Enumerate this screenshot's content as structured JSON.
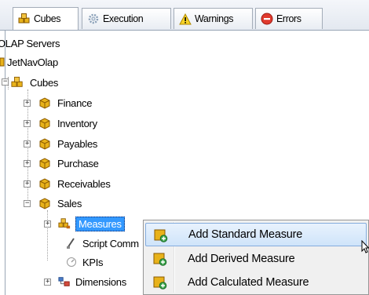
{
  "tabs": [
    {
      "label": "Cubes",
      "icon": "cubes-icon",
      "active": true
    },
    {
      "label": "Execution",
      "icon": "gear-icon",
      "active": false
    },
    {
      "label": "Warnings",
      "icon": "warning-icon",
      "active": false
    },
    {
      "label": "Errors",
      "icon": "error-icon",
      "active": false
    }
  ],
  "tree": {
    "root": "OLAP Servers",
    "server": "JetNavOlap",
    "cubes": "Cubes",
    "children": [
      "Finance",
      "Inventory",
      "Payables",
      "Purchase",
      "Receivables",
      "Sales"
    ],
    "sales_children": [
      "Measures",
      "Script Comm",
      "KPIs",
      "Dimensions"
    ]
  },
  "context_menu": {
    "items": [
      {
        "label": "Add Standard Measure",
        "hovered": true
      },
      {
        "label": "Add Derived Measure",
        "hovered": false
      },
      {
        "label": "Add Calculated Measure",
        "hovered": false
      }
    ]
  },
  "colors": {
    "selection": "#3399ff",
    "menu_hover": "#cfe4fa",
    "cube_gold": "#e8b21a"
  }
}
